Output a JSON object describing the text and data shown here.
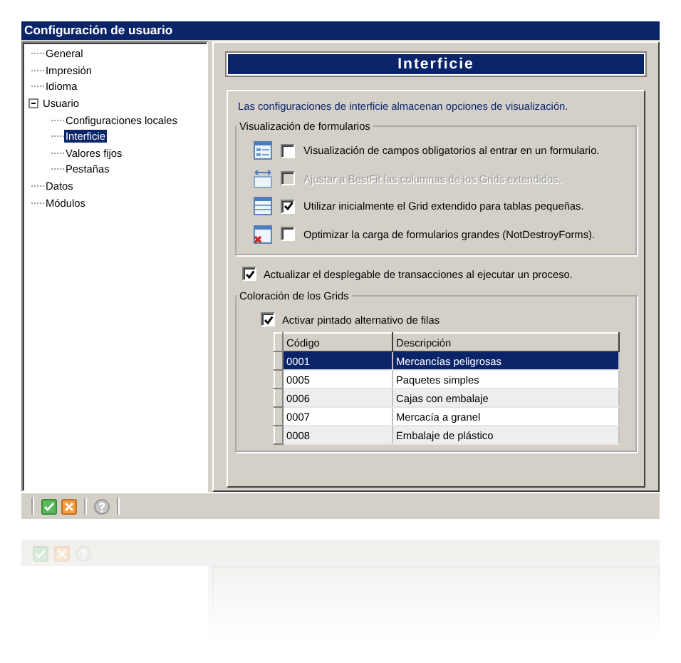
{
  "window": {
    "title": "Configuración de usuario"
  },
  "tree": [
    {
      "label": "General",
      "selected": false
    },
    {
      "label": "Impresión",
      "selected": false
    },
    {
      "label": "Idioma",
      "selected": false
    },
    {
      "label": "Usuario",
      "selected": false,
      "expanded": true,
      "children": [
        {
          "label": "Configuraciones locales",
          "selected": false
        },
        {
          "label": "Interficie",
          "selected": true
        },
        {
          "label": "Valores fijos",
          "selected": false
        },
        {
          "label": "Pestañas",
          "selected": false
        }
      ]
    },
    {
      "label": "Datos",
      "selected": false
    },
    {
      "label": "Módulos",
      "selected": false
    }
  ],
  "header": {
    "title": "Interficie"
  },
  "description": "Las configuraciones de interficie almacenan opciones de visualización.",
  "form_group": {
    "legend": "Visualización de formularios",
    "options": [
      {
        "label": "Visualización de campos obligatorios al entrar en un formulario.",
        "checked": false,
        "disabled": false
      },
      {
        "label": "Ajustar a BestFit las columnas de los Grids extendidos.",
        "checked": false,
        "disabled": true
      },
      {
        "label": "Utilizar inicialmente el Grid extendido para tablas pequeñas.",
        "checked": true,
        "disabled": false
      },
      {
        "label": "Optimizar la carga de formularios grandes (NotDestroyForms).",
        "checked": false,
        "disabled": false
      }
    ]
  },
  "update_option": {
    "label": "Actualizar el desplegable de transacciones al ejecutar un proceso.",
    "checked": true
  },
  "grid_group": {
    "legend": "Coloración de los Grids",
    "alternate": {
      "label": "Activar pintado alternativo de filas",
      "checked": true
    },
    "table": {
      "columns": [
        "Código",
        "Descripción"
      ],
      "rows": [
        {
          "cells": [
            "0001",
            "Mercancías peligrosas"
          ],
          "selected": true
        },
        {
          "cells": [
            "0005",
            "Paquetes simples"
          ],
          "selected": false
        },
        {
          "cells": [
            "0006",
            "Cajas con embalaje"
          ],
          "selected": false
        },
        {
          "cells": [
            "0007",
            "Mercacía a granel"
          ],
          "selected": false
        },
        {
          "cells": [
            "0008",
            "Embalaje de plástico"
          ],
          "selected": false
        }
      ]
    }
  },
  "toolbar": [
    {
      "kind": "accept"
    },
    {
      "kind": "cancel"
    },
    {
      "kind": "help"
    }
  ]
}
